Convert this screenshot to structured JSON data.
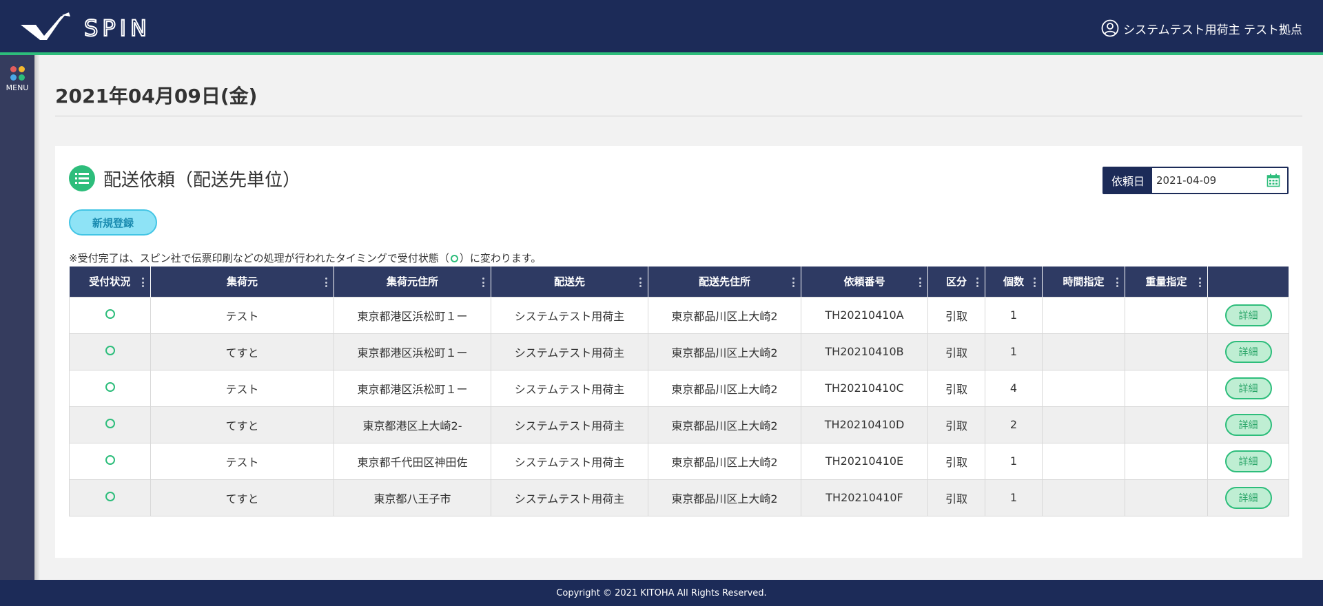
{
  "header": {
    "logo_text": "SPIN",
    "user_label": "システムテスト用荷主 テスト拠点"
  },
  "sidebar": {
    "menu_label": "MENU",
    "dot_colors": [
      "#e35d5d",
      "#f5b82e",
      "#4aa8e8",
      "#2dbd7b"
    ]
  },
  "page": {
    "date": "2021年04月09日(金)"
  },
  "section": {
    "title": "配送依頼（配送先単位）",
    "filter_label": "依頼日",
    "filter_value": "2021-04-09",
    "new_button": "新規登録",
    "note_before": "※受付完了は、スピン社で伝票印刷などの処理が行われたタイミングで受付状態（",
    "note_after": "）に変わります。"
  },
  "table": {
    "columns": [
      "受付状況",
      "集荷元",
      "集荷元住所",
      "配送先",
      "配送先住所",
      "依頼番号",
      "区分",
      "個数",
      "時間指定",
      "重量指定",
      ""
    ],
    "rows": [
      {
        "status": "○",
        "origin": "テスト",
        "origin_addr": "東京都港区浜松町１ー",
        "dest": "システムテスト用荷主",
        "dest_addr": "東京都品川区上大崎2",
        "req_no": "TH20210410A",
        "kind": "引取",
        "count": "1",
        "time": "",
        "weight": "",
        "action": "詳細"
      },
      {
        "status": "○",
        "origin": "てすと",
        "origin_addr": "東京都港区浜松町１ー",
        "dest": "システムテスト用荷主",
        "dest_addr": "東京都品川区上大崎2",
        "req_no": "TH20210410B",
        "kind": "引取",
        "count": "1",
        "time": "",
        "weight": "",
        "action": "詳細"
      },
      {
        "status": "○",
        "origin": "テスト",
        "origin_addr": "東京都港区浜松町１ー",
        "dest": "システムテスト用荷主",
        "dest_addr": "東京都品川区上大崎2",
        "req_no": "TH20210410C",
        "kind": "引取",
        "count": "4",
        "time": "",
        "weight": "",
        "action": "詳細"
      },
      {
        "status": "○",
        "origin": "てすと",
        "origin_addr": "東京都港区上大崎2-",
        "dest": "システムテスト用荷主",
        "dest_addr": "東京都品川区上大崎2",
        "req_no": "TH20210410D",
        "kind": "引取",
        "count": "2",
        "time": "",
        "weight": "",
        "action": "詳細"
      },
      {
        "status": "○",
        "origin": "テスト",
        "origin_addr": "東京都千代田区神田佐",
        "dest": "システムテスト用荷主",
        "dest_addr": "東京都品川区上大崎2",
        "req_no": "TH20210410E",
        "kind": "引取",
        "count": "1",
        "time": "",
        "weight": "",
        "action": "詳細"
      },
      {
        "status": "○",
        "origin": "てすと",
        "origin_addr": "東京都八王子市",
        "dest": "システムテスト用荷主",
        "dest_addr": "東京都品川区上大崎2",
        "req_no": "TH20210410F",
        "kind": "引取",
        "count": "1",
        "time": "",
        "weight": "",
        "action": "詳細"
      }
    ]
  },
  "footer": {
    "copyright": "Copyright © 2021 KITOHA All Rights Reserved."
  }
}
